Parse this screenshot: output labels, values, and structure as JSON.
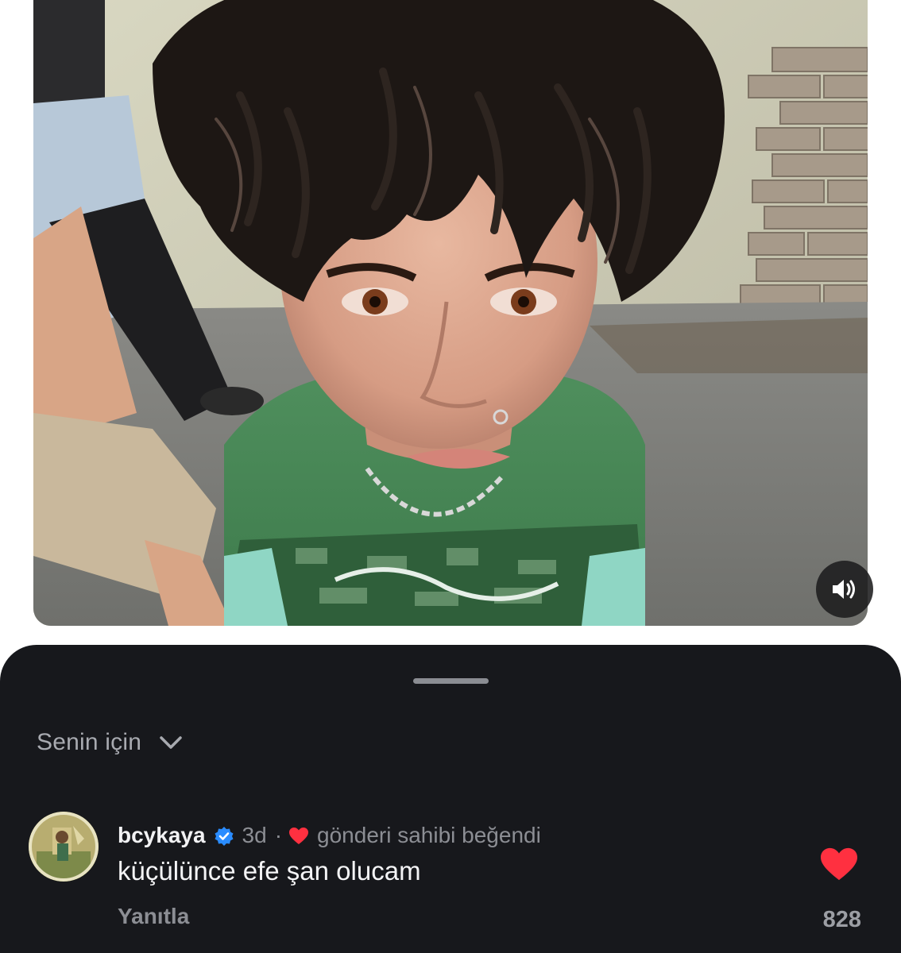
{
  "post": {
    "media_alt": "",
    "sound_icon": "speaker-volume-icon"
  },
  "comments_sheet": {
    "filter_label": "Senin için",
    "filter_icon": "chevron-down-icon",
    "comment": {
      "username": "bcykaya",
      "verified": true,
      "time": "3d",
      "separator": "·",
      "liked_by_author_text": "gönderi sahibi beğendi",
      "text": "küçülünce efe şan olucam",
      "reply_label": "Yanıtla",
      "like_count": "828"
    }
  },
  "colors": {
    "sheet_background": "#17181c",
    "heart_red": "#ff3040",
    "verified_blue": "#2a8cff",
    "muted_text": "#8c8e94"
  }
}
